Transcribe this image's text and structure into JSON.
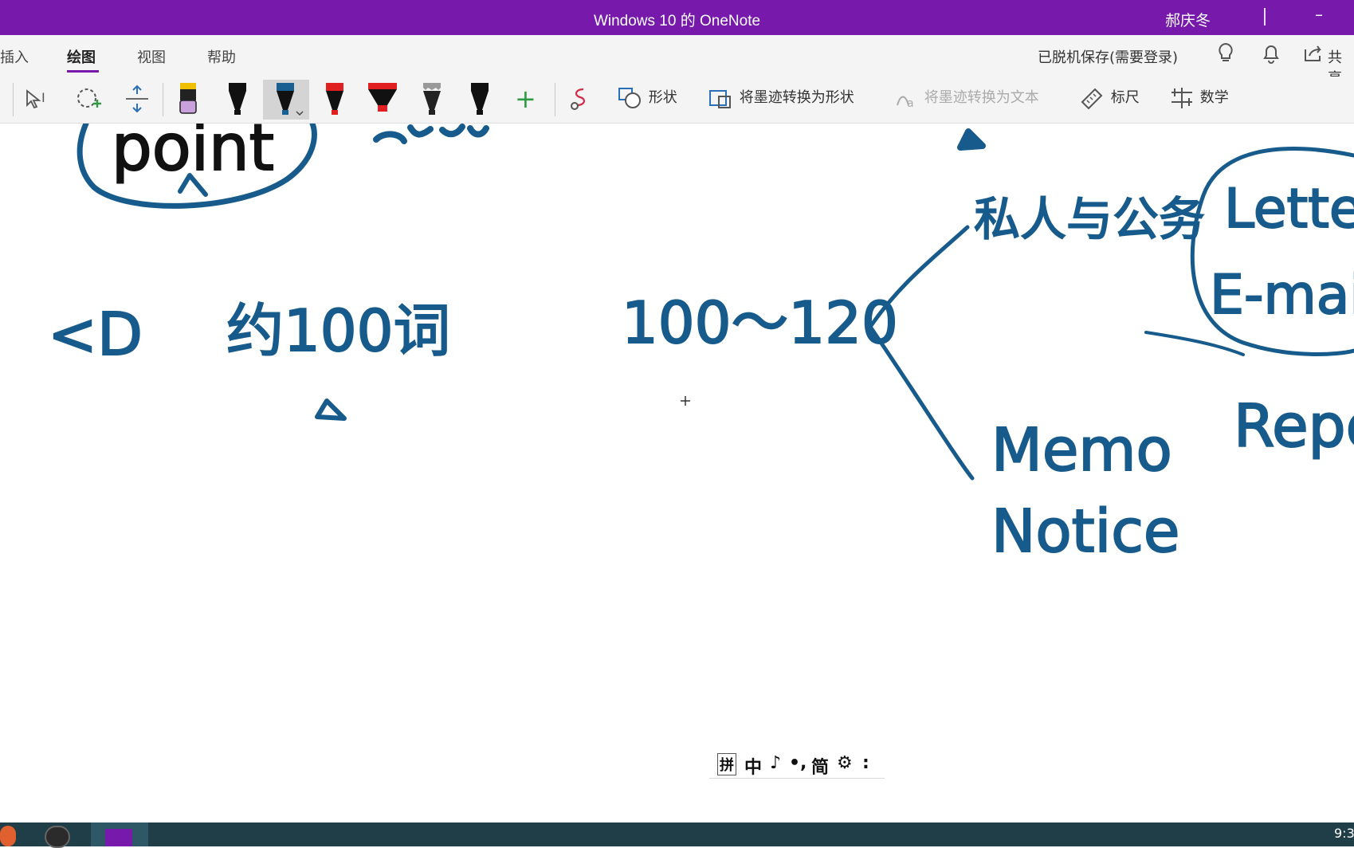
{
  "window": {
    "title": "Windows 10 的 OneNote",
    "user": "郝庆冬",
    "minimize_glyph": "–"
  },
  "tabs": [
    {
      "label": "插入",
      "active": false
    },
    {
      "label": "绘图",
      "active": true
    },
    {
      "label": "视图",
      "active": false
    },
    {
      "label": "帮助",
      "active": false
    }
  ],
  "header": {
    "status": "已脱机保存(需要登录)",
    "share_label": "共享",
    "icons": [
      "lightbulb-icon",
      "bell-icon",
      "share-icon"
    ]
  },
  "toolbar": {
    "tools": [
      "type-select-icon",
      "lasso-select-icon",
      "add-space-icon"
    ],
    "pens": [
      {
        "name": "eraser",
        "color": "#b689c9"
      },
      {
        "name": "pen-black",
        "color": "#111111"
      },
      {
        "name": "pen-blue",
        "color": "#1a5f91",
        "selected": true
      },
      {
        "name": "pen-red",
        "color": "#e02020"
      },
      {
        "name": "highlighter-red",
        "color": "#e02020"
      },
      {
        "name": "pencil-black",
        "color": "#222222"
      },
      {
        "name": "pen-black-2",
        "color": "#111111"
      }
    ],
    "add_pen_glyph": "+",
    "shapes_label": "形状",
    "ink_to_shape_label": "将墨迹转换为形状",
    "ink_to_text_label": "将墨迹转换为文本",
    "ruler_label": "标尺",
    "math_label": "数学"
  },
  "ink": {
    "color": "#175b8c",
    "point": "point",
    "about_words": "约100词",
    "note_mark": "<D",
    "range": "100～120",
    "private_letters": "私人与公务",
    "letter": "Letter",
    "email": "E-mail",
    "memo": "Memo",
    "report": "Report",
    "notice": "Notice"
  },
  "ime": {
    "items": [
      "拼",
      "中",
      "♪",
      "•,",
      "简",
      "⚙",
      ":"
    ]
  },
  "taskbar": {
    "clock": "9:3"
  }
}
